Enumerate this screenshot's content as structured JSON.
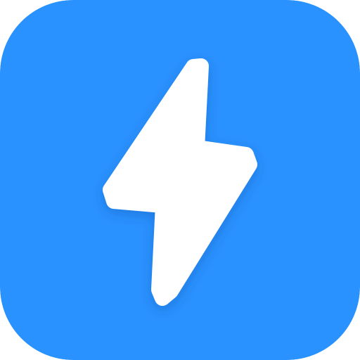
{
  "icon": {
    "name": "lightning-bolt-icon",
    "background_color": "#2A92FF",
    "glyph_color": "#FFFFFF"
  }
}
